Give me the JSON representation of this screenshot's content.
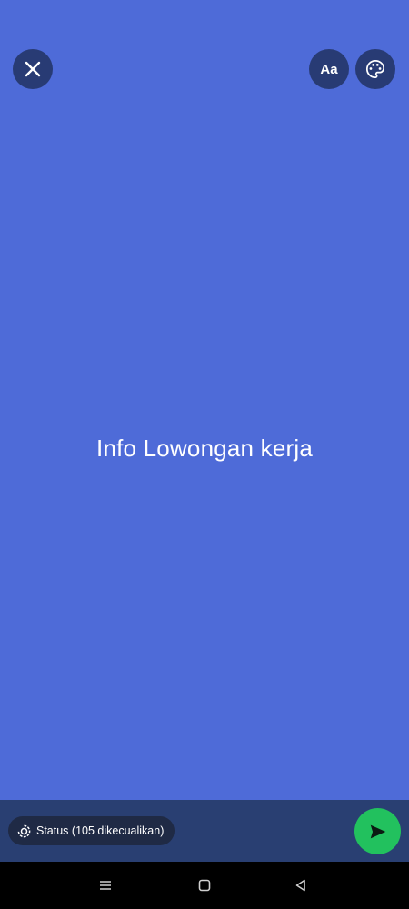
{
  "editor": {
    "status_text": "Info Lowongan kerja",
    "background_color": "#4e6bd8",
    "font_button_label": "Aa",
    "close_icon": "close-icon",
    "palette_icon": "palette-icon"
  },
  "footer": {
    "audience_label": "Status (105 dikecualikan)",
    "audience_icon": "status-icon",
    "send_icon": "send-icon",
    "send_color": "#22c15e"
  },
  "navigation": {
    "menu_icon": "menu-icon",
    "home_icon": "home-icon",
    "back_icon": "back-icon"
  }
}
